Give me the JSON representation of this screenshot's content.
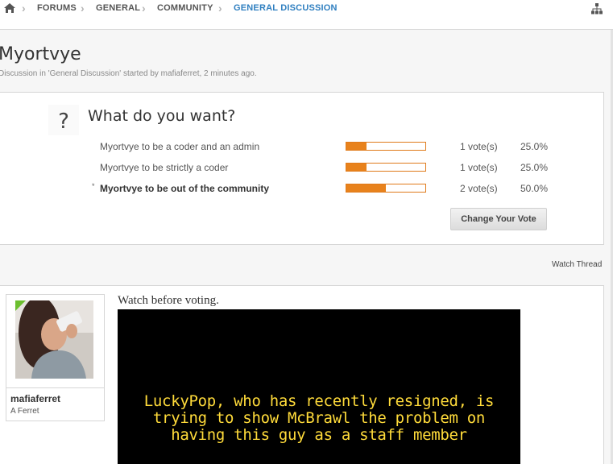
{
  "breadcrumb": {
    "home_icon": "home-icon",
    "items": [
      "FORUMS",
      "GENERAL",
      "COMMUNITY",
      "GENERAL DISCUSSION"
    ],
    "sitemap_icon": "sitemap-icon"
  },
  "thread": {
    "title": "Myortvye",
    "meta": "Discussion in 'General Discussion' started by mafiaferret, 2 minutes ago."
  },
  "poll": {
    "icon_glyph": "?",
    "question": "What do you want?",
    "options": [
      {
        "label": "Myortvye to be a coder and an admin",
        "votes": "1 vote(s)",
        "percent": "25.0%",
        "fill": 25,
        "voted": false
      },
      {
        "label": "Myortvye to be strictly a coder",
        "votes": "1 vote(s)",
        "percent": "25.0%",
        "fill": 25,
        "voted": false
      },
      {
        "label": "Myortvye to be out of the community",
        "votes": "2 vote(s)",
        "percent": "50.0%",
        "fill": 50,
        "voted": true
      }
    ],
    "voted_marker": "*",
    "change_vote_label": "Change Your Vote"
  },
  "watch_thread_label": "Watch Thread",
  "post": {
    "username": "mafiaferret",
    "user_title": "A Ferret",
    "text": "Watch before voting.",
    "video_subtitle": "LuckyPop, who has recently resigned, is\ntrying to show McBrawl the problem on\nhaving this guy as a staff member"
  },
  "colors": {
    "accent": "#2f7fc0",
    "bar": "#e8821c",
    "online": "#6cbf2f",
    "subtitle": "#ffdb3a"
  }
}
